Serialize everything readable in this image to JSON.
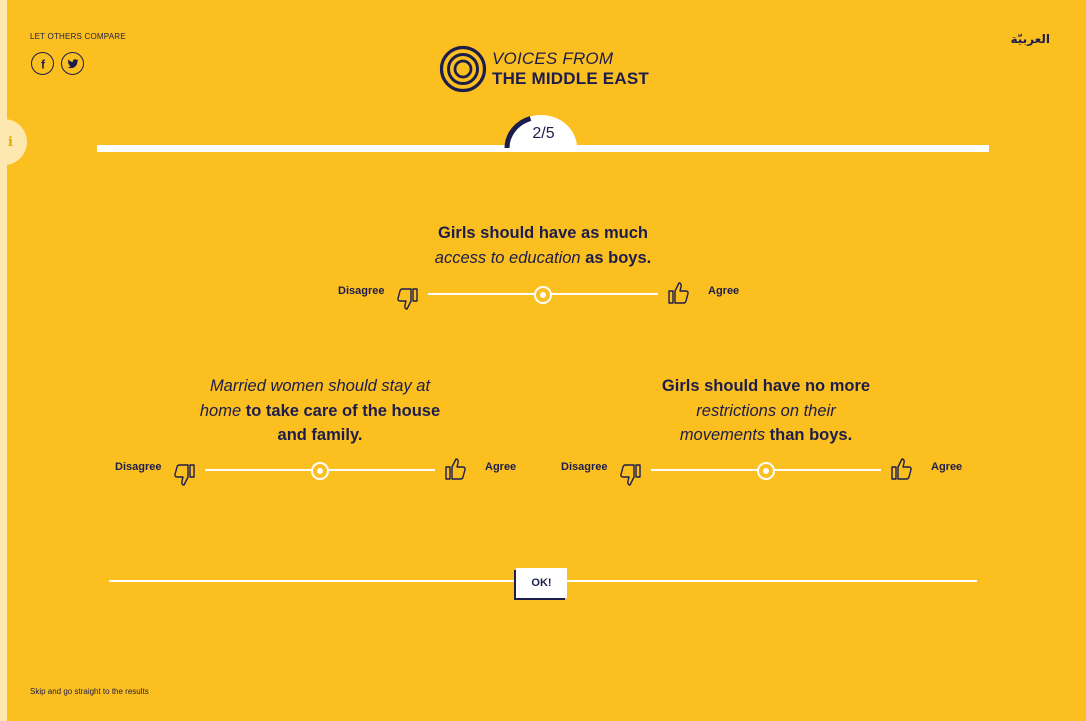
{
  "header": {
    "share_label": "LET OTHERS COMPARE",
    "social": [
      {
        "icon": "facebook-icon",
        "glyph": "f"
      },
      {
        "icon": "twitter-icon"
      }
    ],
    "language": "العربيّة",
    "logo": {
      "line1": "VOICES FROM",
      "line2": "THE MIDDLE EAST",
      "icon": "concentric-circles-logo"
    }
  },
  "progress": {
    "label": "2/5",
    "current": 2,
    "total": 5
  },
  "questions": [
    {
      "lines": [
        [
          {
            "text": "Girls should have as much",
            "style": "bold"
          }
        ],
        [
          {
            "text": "access to education",
            "style": "italic"
          },
          {
            "text": " as boys.",
            "style": "bold"
          }
        ]
      ],
      "disagree": "Disagree",
      "agree": "Agree",
      "value": 0.5
    },
    {
      "lines": [
        [
          {
            "text": "Married women should stay at",
            "style": "italic"
          }
        ],
        [
          {
            "text": "home",
            "style": "italic"
          },
          {
            "text": " to take care of the house",
            "style": "bold"
          }
        ],
        [
          {
            "text": "and family.",
            "style": "bold"
          }
        ]
      ],
      "disagree": "Disagree",
      "agree": "Agree",
      "value": 0.5
    },
    {
      "lines": [
        [
          {
            "text": "Girls should have no more",
            "style": "bold"
          }
        ],
        [
          {
            "text": "restrictions on their",
            "style": "italic"
          }
        ],
        [
          {
            "text": "movements",
            "style": "italic"
          },
          {
            "text": " than boys.",
            "style": "bold"
          }
        ]
      ],
      "disagree": "Disagree",
      "agree": "Agree",
      "value": 0.5
    }
  ],
  "submit": {
    "label": "OK!"
  },
  "footer": {
    "skip": "Skip and go straight to the results"
  },
  "colors": {
    "background": "#fbbf1f",
    "ink": "#1d1d4b",
    "white": "#ffffff",
    "strip": "#fde9b0"
  }
}
